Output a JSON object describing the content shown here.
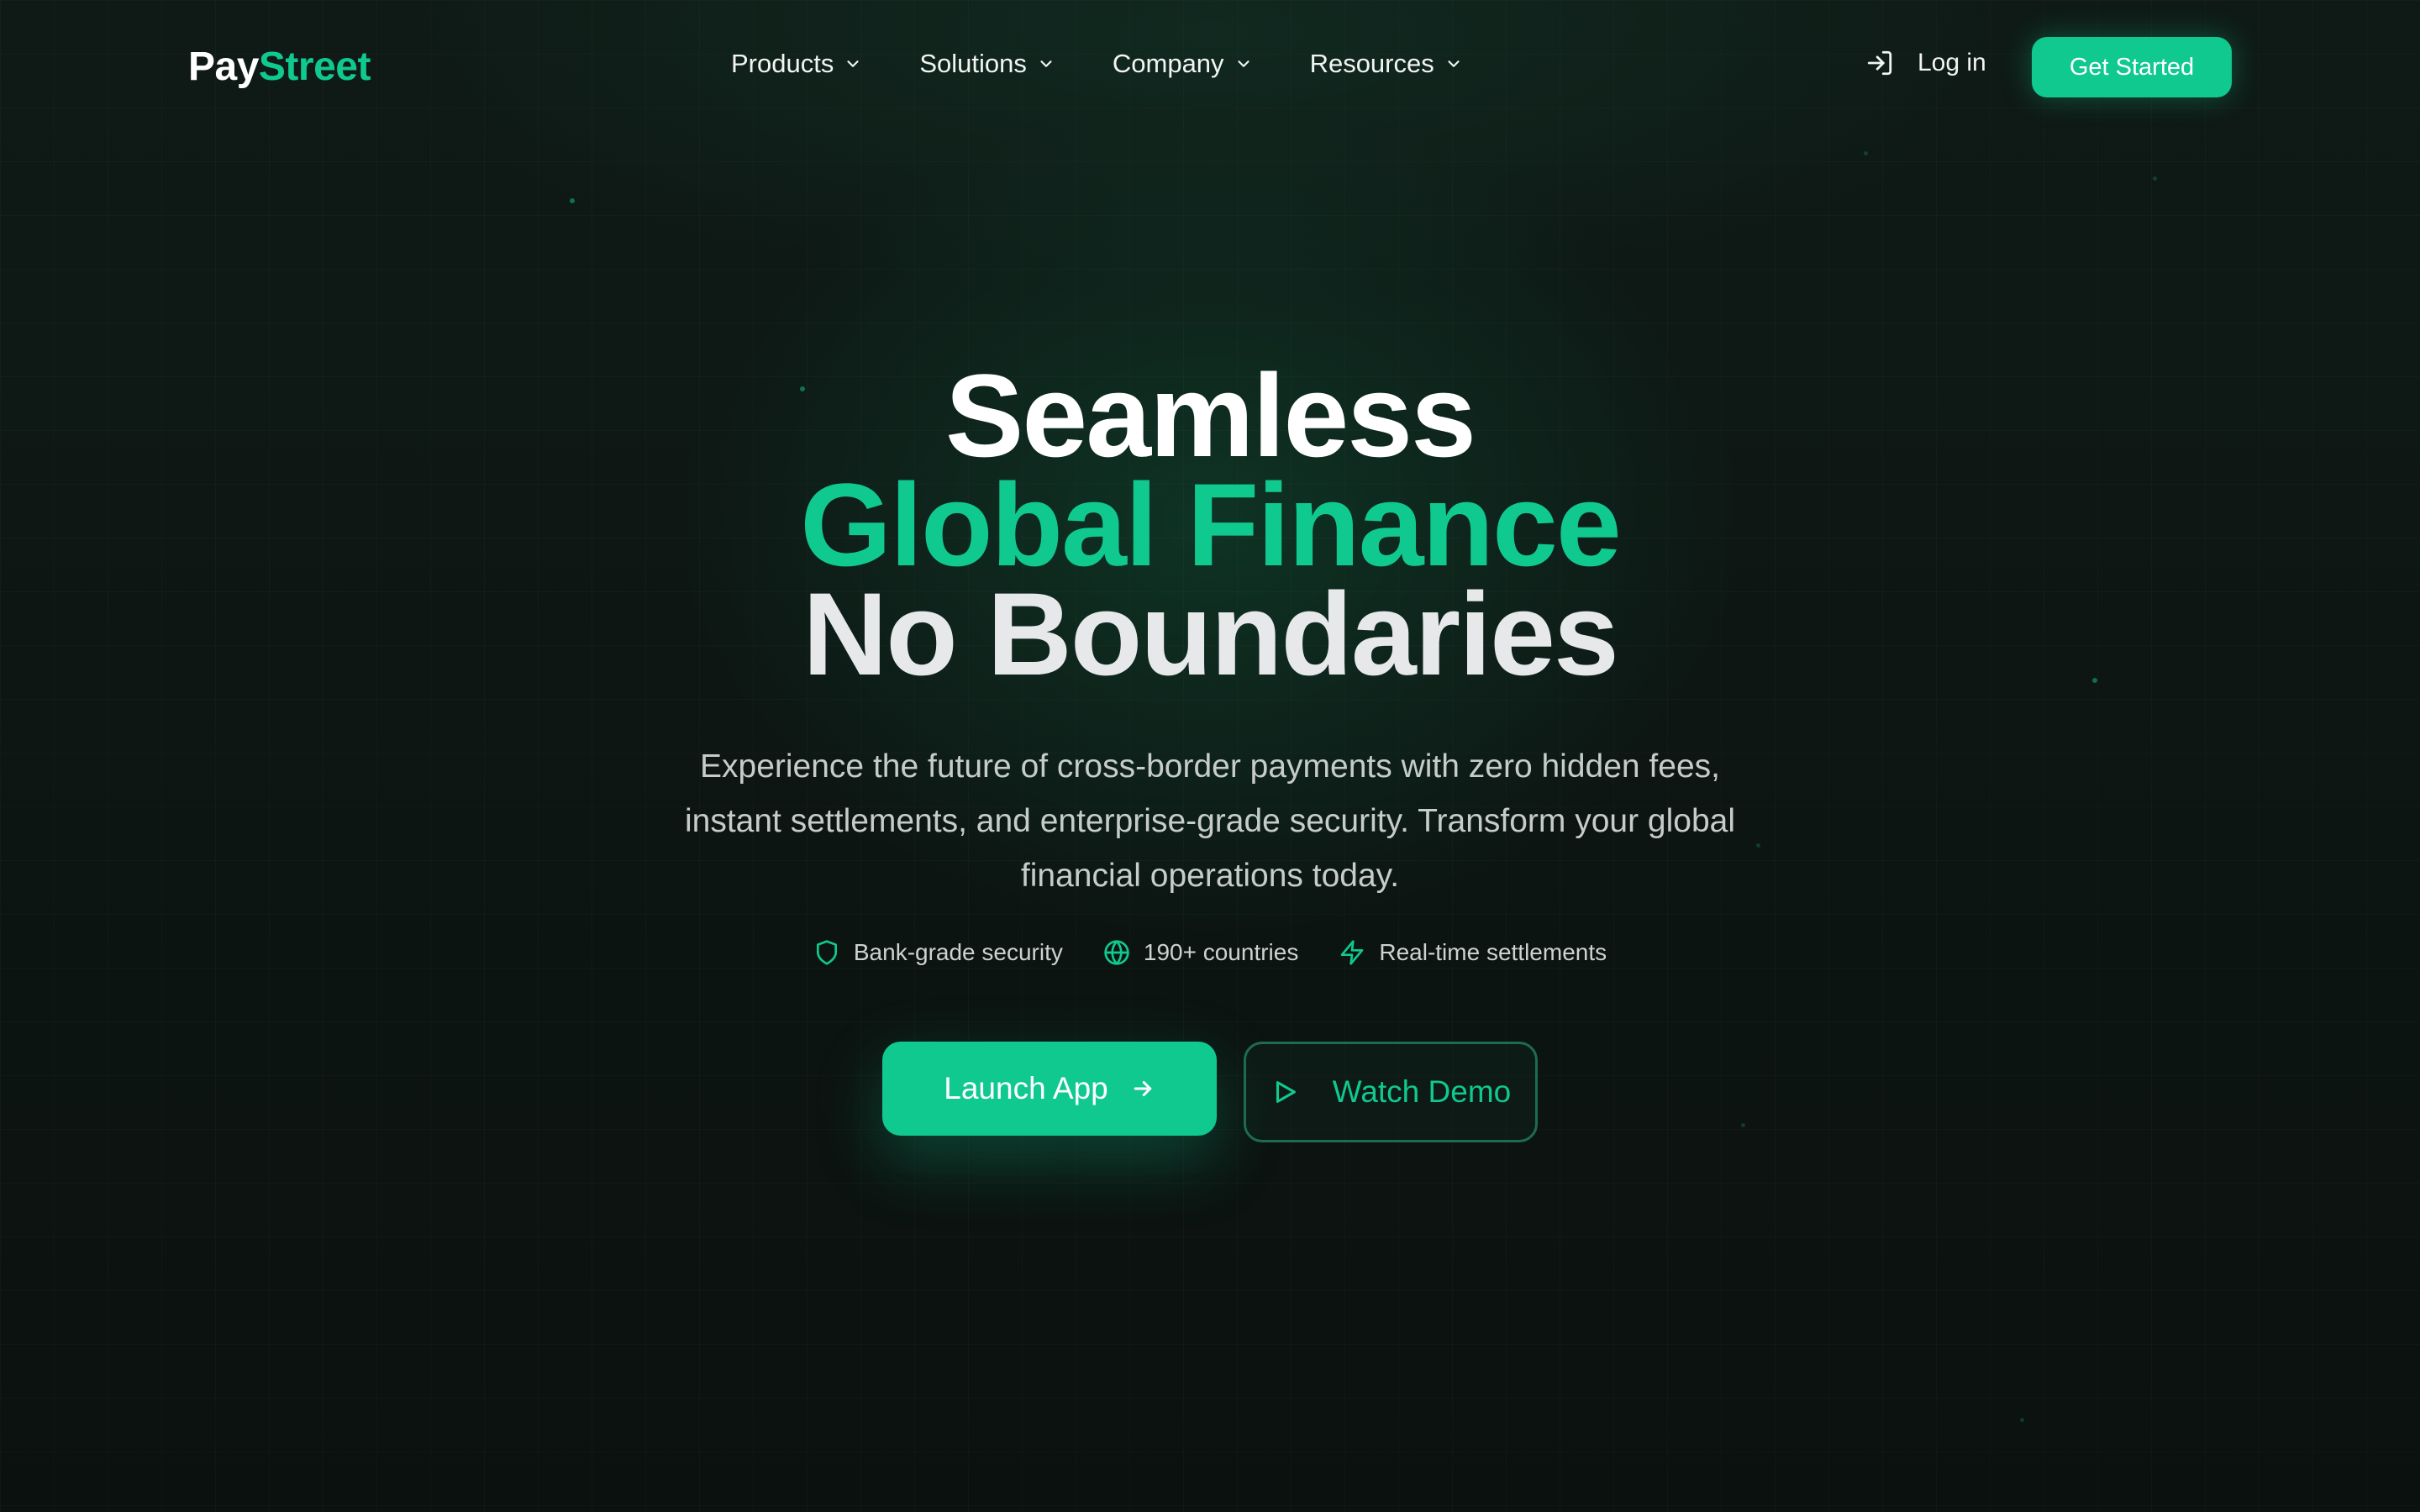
{
  "brand": {
    "name_part1": "Pay",
    "name_part2": "Street",
    "accent_color": "#10c98f"
  },
  "nav": {
    "items": [
      {
        "label": "Products",
        "icon": "chevron-down-icon"
      },
      {
        "label": "Solutions",
        "icon": "chevron-down-icon"
      },
      {
        "label": "Company",
        "icon": "chevron-down-icon"
      },
      {
        "label": "Resources",
        "icon": "chevron-down-icon"
      }
    ],
    "login": {
      "label": "Log in",
      "icon": "login-icon"
    },
    "cta": {
      "label": "Get Started"
    }
  },
  "hero": {
    "line1": "Seamless",
    "line2": "Global Finance",
    "line3": "No Boundaries",
    "subtitle": "Experience the future of cross-border payments with zero hidden fees, instant settlements, and enterprise-grade security. Transform your global financial operations today.",
    "features": [
      {
        "label": "Bank-grade security",
        "icon": "shield-icon"
      },
      {
        "label": "190+ countries",
        "icon": "globe-icon"
      },
      {
        "label": "Real-time settlements",
        "icon": "lightning-icon"
      }
    ],
    "primary_button": {
      "label": "Launch App",
      "icon": "arrow-right-icon"
    },
    "secondary_button": {
      "label": "Watch Demo",
      "icon": "play-icon"
    }
  },
  "colors": {
    "background": "#0c1210",
    "primary": "#10c98f",
    "text": "#f2f5f4",
    "muted": "#c6ccca"
  }
}
